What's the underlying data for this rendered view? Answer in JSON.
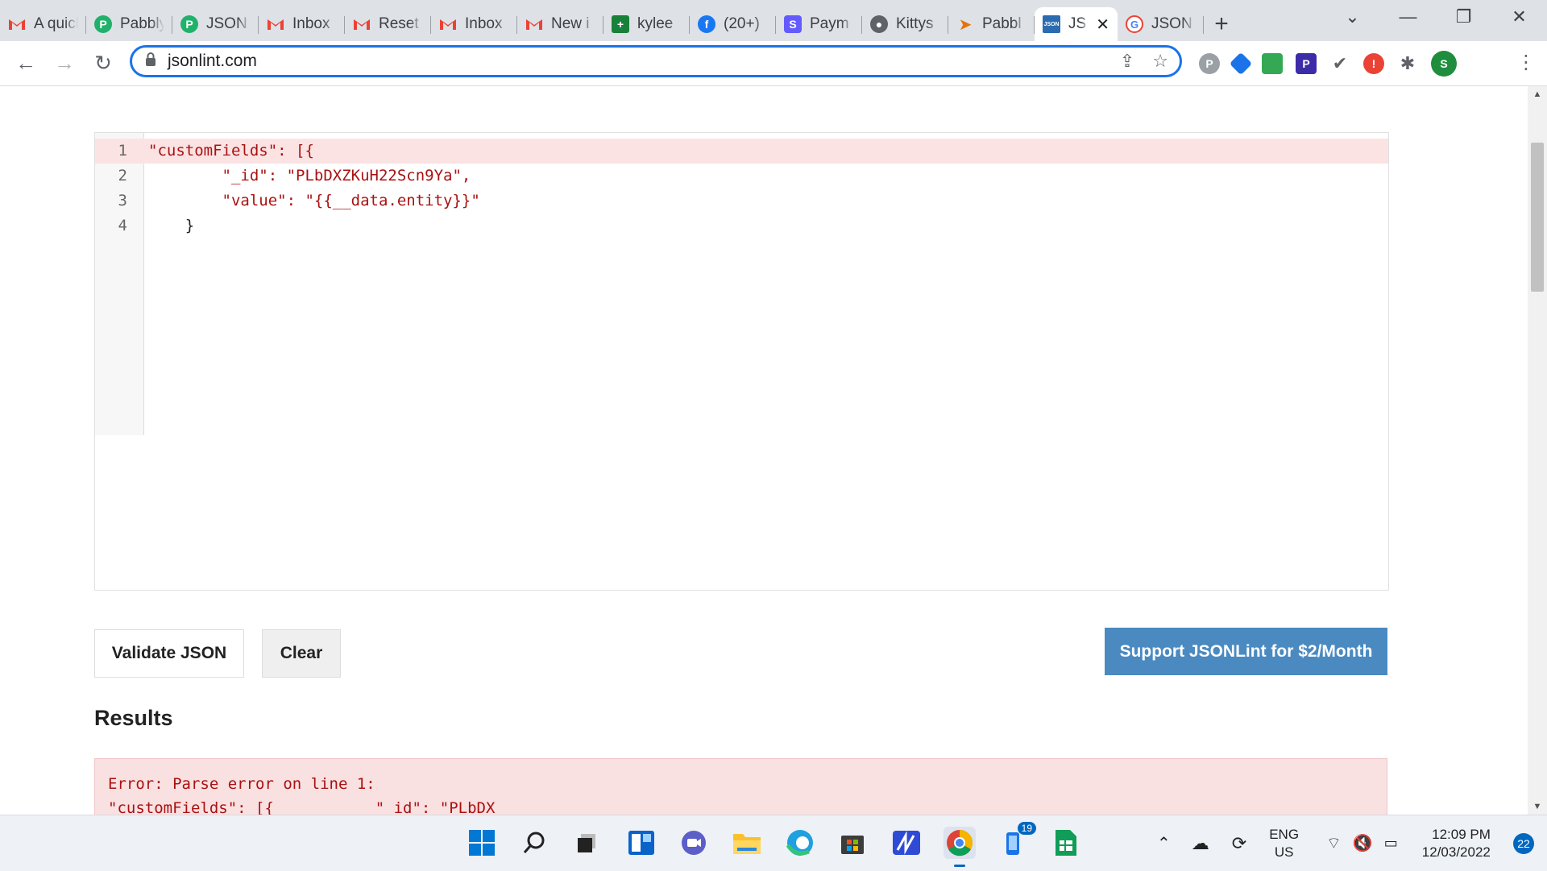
{
  "browser": {
    "tabs": [
      {
        "title": "A quick",
        "favicon": "gmail-icon"
      },
      {
        "title": "Pabbly",
        "favicon": "pabbly-icon"
      },
      {
        "title": "JSON",
        "favicon": "pabbly-icon"
      },
      {
        "title": "Inbox",
        "favicon": "gmail-icon"
      },
      {
        "title": "Reset",
        "favicon": "gmail-icon"
      },
      {
        "title": "Inbox",
        "favicon": "gmail-icon"
      },
      {
        "title": "New i",
        "favicon": "gmail-icon"
      },
      {
        "title": "kylee",
        "favicon": "sheets-icon"
      },
      {
        "title": "(20+)",
        "favicon": "facebook-icon"
      },
      {
        "title": "Paym",
        "favicon": "stripe-icon"
      },
      {
        "title": "Kittys",
        "favicon": "kitty-icon"
      },
      {
        "title": "Pabbl",
        "favicon": "send-icon"
      },
      {
        "title": "JS",
        "favicon": "jsonlint-icon",
        "active": true
      },
      {
        "title": "JSON",
        "favicon": "google-icon"
      }
    ],
    "address": "jsonlint.com",
    "profile_initial": "S"
  },
  "editor": {
    "lines": [
      {
        "n": "1",
        "text": "\"customFields\": [{",
        "error": true
      },
      {
        "n": "2",
        "text": "        \"_id\": \"PLbDXZKuH22Scn9Ya\","
      },
      {
        "n": "3",
        "text": "        \"value\": \"{{__data.entity}}\""
      },
      {
        "n": "4",
        "text": "    }"
      }
    ]
  },
  "buttons": {
    "validate": "Validate JSON",
    "clear": "Clear",
    "support": "Support JSONLint for $2/Month"
  },
  "results": {
    "heading": "Results",
    "error_line1": "Error: Parse error on line 1:",
    "error_line2": "\"customFields\": [{           \"_id\": \"PLbDX"
  },
  "taskbar": {
    "lang_top": "ENG",
    "lang_bottom": "US",
    "time": "12:09 PM",
    "date": "12/03/2022",
    "notifications": "22",
    "store_badge": "19"
  }
}
